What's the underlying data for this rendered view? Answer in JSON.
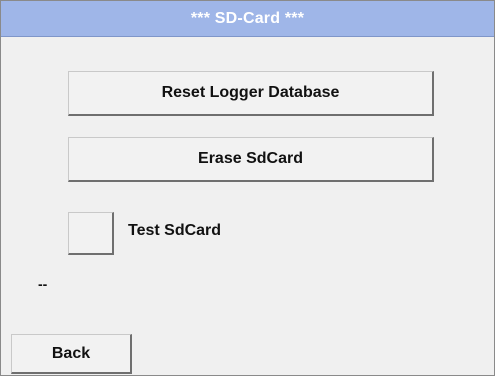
{
  "window": {
    "title": "***  SD-Card  ***"
  },
  "actions": {
    "reset_logger_database": "Reset Logger Database",
    "erase_sdcard": "Erase SdCard",
    "test_sdcard": "Test SdCard",
    "back": "Back"
  },
  "status": {
    "text": "--"
  }
}
